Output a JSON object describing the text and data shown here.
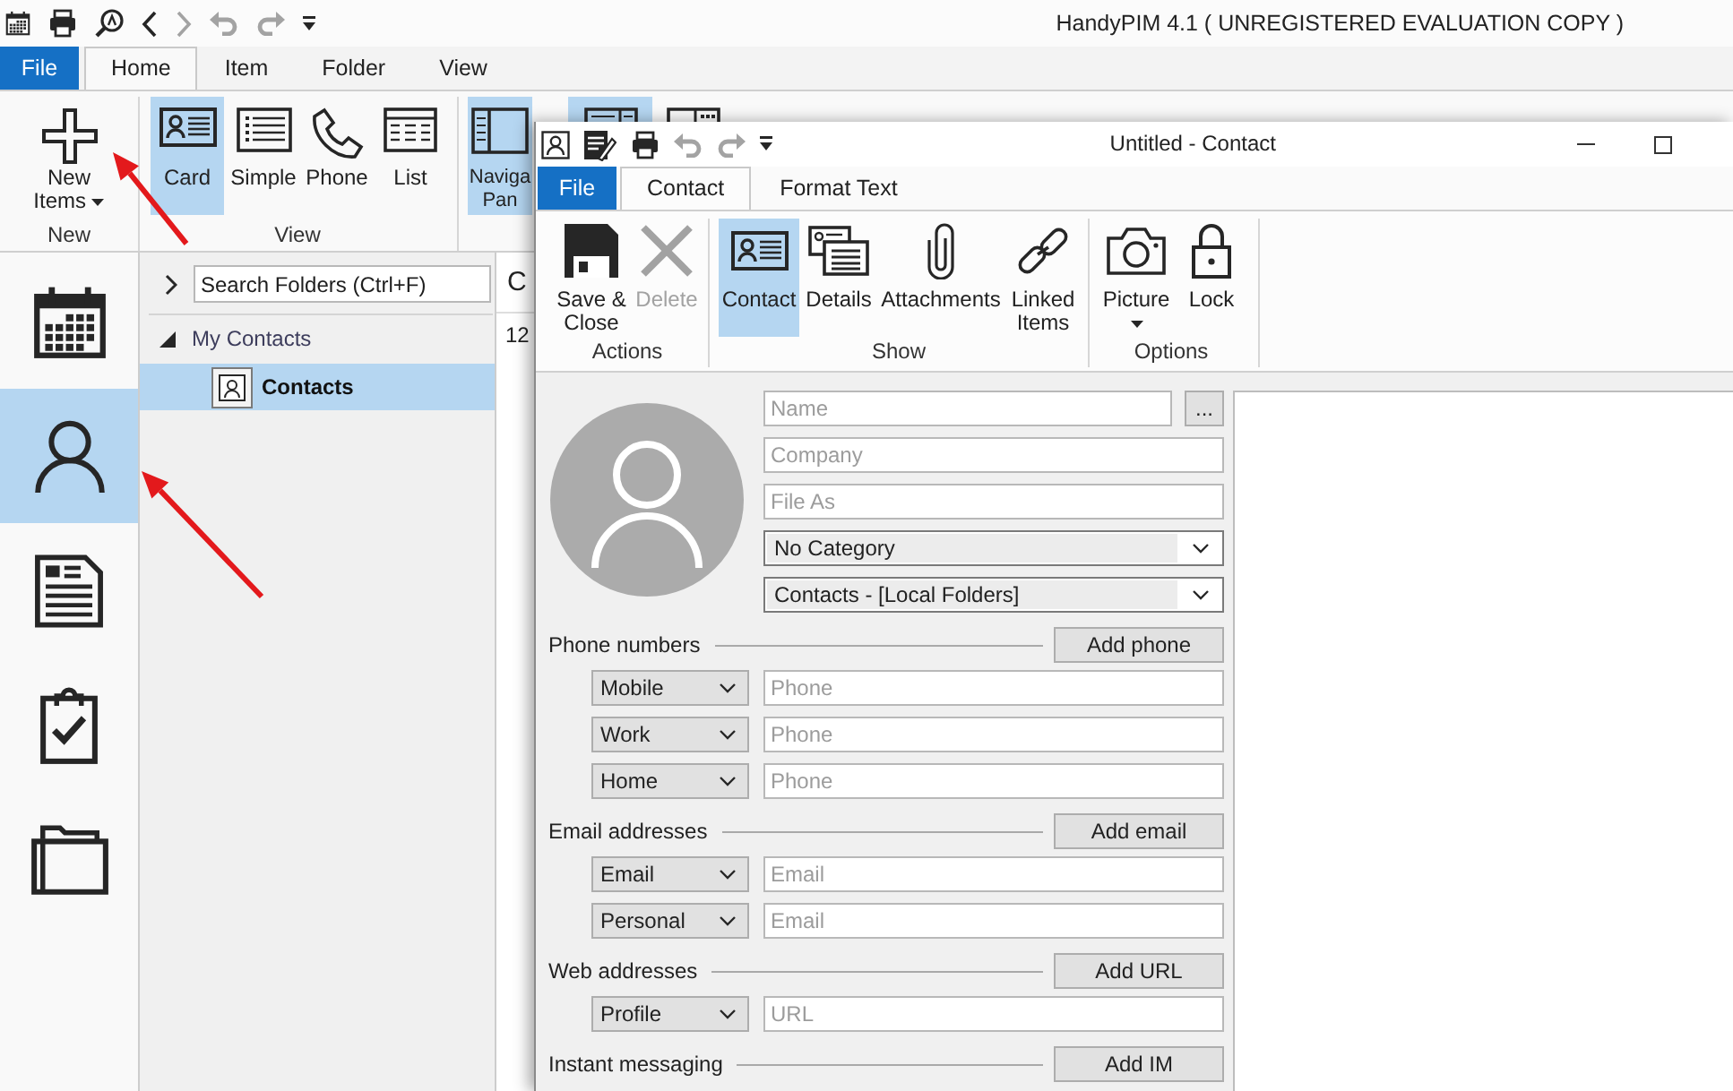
{
  "main_window": {
    "quick_access": [
      {
        "kind": "calendar",
        "disabled": false
      },
      {
        "kind": "print",
        "disabled": false
      },
      {
        "kind": "find",
        "disabled": false
      },
      {
        "kind": "back",
        "disabled": false
      },
      {
        "kind": "forward",
        "disabled": true
      },
      {
        "kind": "undo",
        "disabled": true
      },
      {
        "kind": "redo",
        "disabled": true
      },
      {
        "kind": "customize",
        "disabled": false
      }
    ],
    "title": "HandyPIM 4.1 ( UNREGISTERED EVALUATION COPY )",
    "file_tab": "File",
    "tabs": [
      {
        "label": "Home",
        "selected": true
      },
      {
        "label": "Item",
        "selected": false
      },
      {
        "label": "Folder",
        "selected": false
      },
      {
        "label": "View",
        "selected": false
      }
    ],
    "ribbon_groups": [
      {
        "label": "New",
        "buttons": [
          {
            "kind": "new",
            "label": "New Items",
            "dropdown": true,
            "selected": false,
            "disabled": false
          }
        ]
      },
      {
        "label": "View",
        "buttons": [
          {
            "kind": "card",
            "label": "Card",
            "dropdown": false,
            "selected": true,
            "disabled": false
          },
          {
            "kind": "simple",
            "label": "Simple",
            "dropdown": false,
            "selected": false,
            "disabled": false
          },
          {
            "kind": "phone",
            "label": "Phone",
            "dropdown": false,
            "selected": false,
            "disabled": false
          },
          {
            "kind": "list",
            "label": "List",
            "dropdown": false,
            "selected": false,
            "disabled": false
          }
        ]
      },
      {
        "buttons": [
          {
            "kind": "pane",
            "label": "Naviga Pan",
            "dropdown": false,
            "selected": true,
            "disabled": false
          },
          {
            "kind": "pane_top",
            "selected": true,
            "disabled": false
          },
          {
            "kind": "grid_top",
            "selected": false,
            "disabled": false
          }
        ]
      }
    ],
    "nav_bar": [
      {
        "kind": "calendar",
        "selected": false
      },
      {
        "kind": "contacts",
        "selected": true
      },
      {
        "kind": "notes",
        "selected": false
      },
      {
        "kind": "tasks",
        "selected": false
      },
      {
        "kind": "folders",
        "selected": false
      }
    ],
    "folder_pane": {
      "search": {
        "placeholder": "Search Folders (Ctrl+F)"
      },
      "tree": [
        {
          "label": "My Contacts",
          "expanded": true,
          "selected": false,
          "children": [
            {
              "label": "Contacts",
              "selected": true
            }
          ]
        }
      ]
    },
    "list_pane": {
      "header": "C",
      "items": [
        "12"
      ]
    }
  },
  "contact_window": {
    "quick_access": [
      {
        "kind": "contact",
        "disabled": false
      },
      {
        "kind": "edit",
        "disabled": false
      },
      {
        "kind": "print",
        "disabled": false
      },
      {
        "kind": "undo",
        "disabled": true
      },
      {
        "kind": "redo",
        "disabled": true
      },
      {
        "kind": "customize",
        "disabled": false
      }
    ],
    "title": "Untitled - Contact",
    "file_tab": "File",
    "tabs": [
      {
        "label": "Contact",
        "selected": true
      },
      {
        "label": "Format Text",
        "selected": false
      }
    ],
    "ribbon_groups": [
      {
        "label": "Actions",
        "buttons": [
          {
            "kind": "save",
            "label": "Save & Close",
            "dropdown": false,
            "selected": false,
            "disabled": false
          },
          {
            "kind": "delete",
            "label": "Delete",
            "dropdown": false,
            "selected": false,
            "disabled": true
          }
        ]
      },
      {
        "label": "Show",
        "buttons": [
          {
            "kind": "card",
            "label": "Contact",
            "dropdown": false,
            "selected": true,
            "disabled": false
          },
          {
            "kind": "details",
            "label": "Details",
            "dropdown": false,
            "selected": false,
            "disabled": false
          },
          {
            "kind": "attachments",
            "label": "Attachments",
            "dropdown": false,
            "selected": false,
            "disabled": false
          },
          {
            "kind": "linked",
            "label": "Linked Items",
            "dropdown": false,
            "selected": false,
            "disabled": false
          }
        ]
      },
      {
        "label": "Options",
        "buttons": [
          {
            "kind": "picture",
            "label": "Picture",
            "dropdown": true,
            "selected": false,
            "disabled": false
          },
          {
            "kind": "lock",
            "label": "Lock",
            "dropdown": false,
            "selected": false,
            "disabled": false
          }
        ]
      }
    ],
    "form": {
      "name_field": {
        "placeholder": "Name"
      },
      "name_button": "...",
      "company_field": {
        "placeholder": "Company"
      },
      "file_as_field": {
        "placeholder": "File As"
      },
      "category_dropdown": {
        "value": "No Category"
      },
      "folder_dropdown": {
        "value": "Contacts - [Local Folders]"
      },
      "sections": [
        {
          "label": "Phone numbers",
          "add_button": "Add phone",
          "rows": [
            {
              "type": "Mobile",
              "placeholder": "Phone"
            },
            {
              "type": "Work",
              "placeholder": "Phone"
            },
            {
              "type": "Home",
              "placeholder": "Phone"
            }
          ]
        },
        {
          "label": "Email addresses",
          "add_button": "Add email",
          "rows": [
            {
              "type": "Email",
              "placeholder": "Email"
            },
            {
              "type": "Personal",
              "placeholder": "Email"
            }
          ]
        },
        {
          "label": "Web addresses",
          "add_button": "Add URL",
          "rows": [
            {
              "type": "Profile",
              "placeholder": "URL"
            }
          ]
        },
        {
          "label": "Instant messaging",
          "add_button": "Add IM"
        }
      ]
    }
  },
  "annotations": [
    {
      "kind": "arrow"
    },
    {
      "kind": "arrow"
    }
  ]
}
